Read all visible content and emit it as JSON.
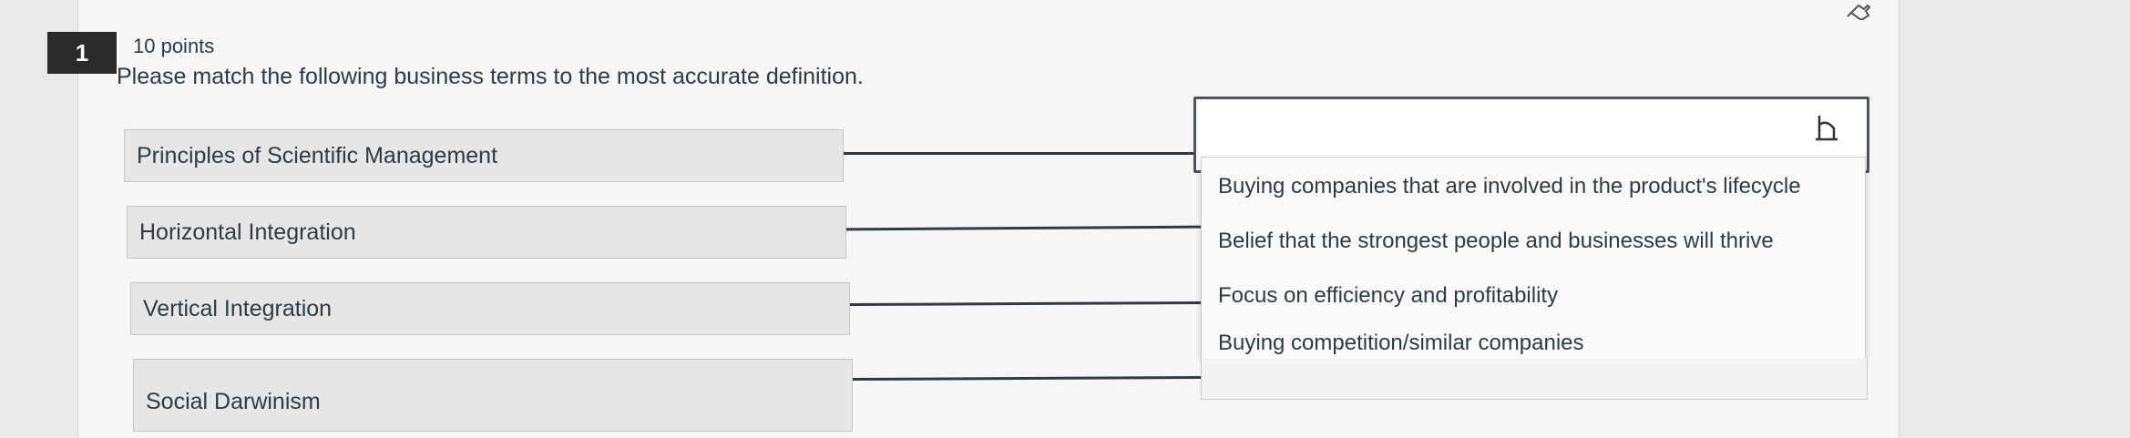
{
  "question": {
    "number": "1",
    "points": "10 points",
    "prompt": "Please match the following business terms to the most accurate definition."
  },
  "terms": [
    "Principles of Scientific Management",
    "Horizontal Integration",
    "Vertical Integration",
    "Social Darwinism"
  ],
  "answer_select": {
    "selected": ""
  },
  "dropdown_options": [
    "Buying companies that are involved in the product's lifecycle",
    "Belief that the strongest people and businesses will thrive",
    "Focus on efficiency and profitability",
    "Buying competition/similar companies"
  ],
  "icons": {
    "pin": "pin-icon",
    "cursor": "text-cursor-icon"
  }
}
